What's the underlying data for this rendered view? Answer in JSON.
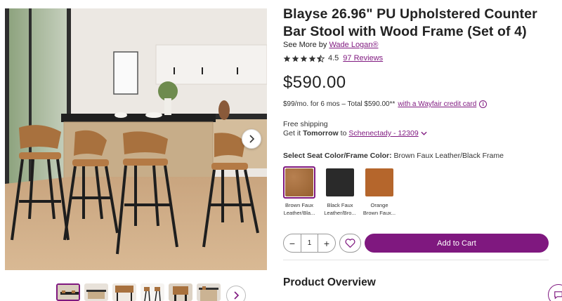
{
  "product": {
    "title": "Blayse 26.96\" PU Upholstered Counter Bar Stool with Wood Frame (Set of 4)",
    "see_more_prefix": "See More by",
    "brand": "Wade Logan®",
    "rating": "4.5",
    "rating_value": 4.5,
    "reviews": "97 Reviews",
    "price": "$590.00"
  },
  "finance": {
    "text": "$99/mo. for 6 mos – Total $590.00**",
    "link": "with a Wayfair credit card"
  },
  "shipping": {
    "free": "Free shipping",
    "get_it": "Get it",
    "when": "Tomorrow",
    "to": "to",
    "location": "Schenectady - 12309"
  },
  "options": {
    "label": "Select Seat Color/Frame Color:",
    "selected": "Brown Faux Leather/Black Frame",
    "swatches": [
      {
        "caption_1": "Brown Faux",
        "caption_2": "Leather/Bla...",
        "color": "#a8713e"
      },
      {
        "caption_1": "Black Faux",
        "caption_2": "Leather/Bro...",
        "color": "#2a2a2a"
      },
      {
        "caption_1": "Orange",
        "caption_2": "Brown Faux...",
        "color": "#b5662c"
      }
    ]
  },
  "cart": {
    "quantity": "1",
    "minus": "−",
    "plus": "+",
    "add_label": "Add to Cart"
  },
  "section": {
    "overview": "Product Overview"
  },
  "colors": {
    "brand_purple": "#7f187f",
    "star": "#333333"
  },
  "icons": {
    "next": "chevron-right-icon",
    "favorite": "heart-icon",
    "dropdown": "chevron-down-icon",
    "info": "info-icon",
    "chat": "chat-icon"
  }
}
